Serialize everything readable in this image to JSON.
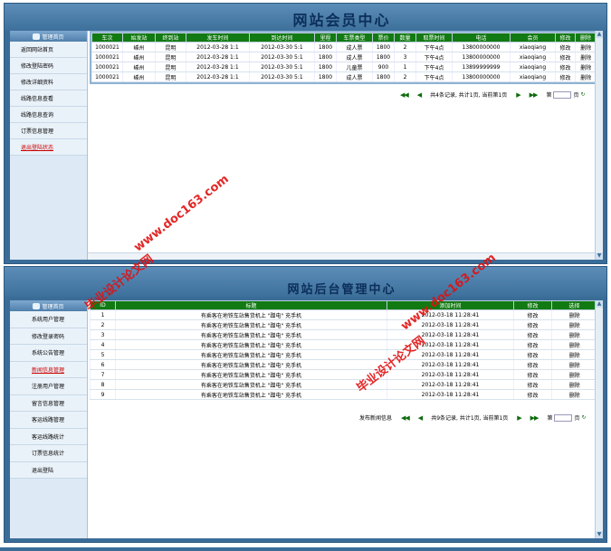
{
  "top": {
    "title": "网站会员中心",
    "sidebar": {
      "header": "管理首页",
      "items": [
        "返回网站首页",
        "修改登陆密码",
        "修改详细资料",
        "线路信息查看",
        "线路信息查询",
        "订票信息管理",
        "退出登陆状态"
      ]
    },
    "columns": [
      "车次",
      "始发站",
      "终到站",
      "发车时间",
      "到达时间",
      "里程",
      "车票类型",
      "票价",
      "数量",
      "取票时间",
      "电话",
      "会员",
      "修改",
      "删除"
    ],
    "rows": [
      [
        "1000021",
        "嵊州",
        "昆明",
        "2012-03-28 1:1",
        "2012-03-30 5:1",
        "1800",
        "成人票",
        "1800",
        "2",
        "下午4点",
        "13800000000",
        "xiaoqiang",
        "修改",
        "删除"
      ],
      [
        "1000021",
        "嵊州",
        "昆明",
        "2012-03-28 1:1",
        "2012-03-30 5:1",
        "1800",
        "成人票",
        "1800",
        "3",
        "下午4点",
        "13800000000",
        "xiaoqiang",
        "修改",
        "删除"
      ],
      [
        "1000021",
        "嵊州",
        "昆明",
        "2012-03-28 1:1",
        "2012-03-30 5:1",
        "1800",
        "儿童票",
        "900",
        "1",
        "下午4点",
        "13899999999",
        "xiaoqiang",
        "修改",
        "删除"
      ],
      [
        "1000021",
        "嵊州",
        "昆明",
        "2012-03-28 1:1",
        "2012-03-30 5:1",
        "1800",
        "成人票",
        "1800",
        "2",
        "下午4点",
        "13800000000",
        "xiaoqiang",
        "修改",
        "删除"
      ]
    ],
    "pager": {
      "first": "◀◀",
      "prev": "◀",
      "summary": "共4条记录, 共计1页, 当前第1页",
      "next": "▶",
      "last": "▶▶",
      "page_label": "第",
      "page_unit": "页"
    }
  },
  "bottom": {
    "title": "网站后台管理中心",
    "sidebar": {
      "header": "管理首页",
      "items": [
        "系统用户管理",
        "修改登录密码",
        "系统公告管理",
        "新闻信息管理",
        "注册用户管理",
        "留言信息管理",
        "客运线路管理",
        "客运线路统计",
        "订票信息统计",
        "退出登陆"
      ]
    },
    "columns": [
      "ID",
      "标题",
      "添加时间",
      "修改",
      "选择"
    ],
    "rows": [
      [
        "1",
        "有乘客在地铁车站售货机上 \"蹭电\" 充手机",
        "2012-03-18 11:28:41",
        "修改",
        "删除"
      ],
      [
        "2",
        "有乘客在地铁车站售货机上 \"蹭电\" 充手机",
        "2012-03-18 11:28:41",
        "修改",
        "删除"
      ],
      [
        "3",
        "有乘客在地铁车站售货机上 \"蹭电\" 充手机",
        "2012-03-18 11:28:41",
        "修改",
        "删除"
      ],
      [
        "4",
        "有乘客在地铁车站售货机上 \"蹭电\" 充手机",
        "2012-03-18 11:28:41",
        "修改",
        "删除"
      ],
      [
        "5",
        "有乘客在地铁车站售货机上 \"蹭电\" 充手机",
        "2012-03-18 11:28:41",
        "修改",
        "删除"
      ],
      [
        "6",
        "有乘客在地铁车站售货机上 \"蹭电\" 充手机",
        "2012-03-18 11:28:41",
        "修改",
        "删除"
      ],
      [
        "7",
        "有乘客在地铁车站售货机上 \"蹭电\" 充手机",
        "2012-03-18 11:28:41",
        "修改",
        "删除"
      ],
      [
        "8",
        "有乘客在地铁车站售货机上 \"蹭电\" 充手机",
        "2012-03-18 11:28:41",
        "修改",
        "删除"
      ],
      [
        "9",
        "有乘客在地铁车站售货机上 \"蹭电\" 充手机",
        "2012-03-18 11:28:41",
        "修改",
        "删除"
      ]
    ],
    "pager": {
      "publish": "发布新闻信息",
      "first": "◀◀",
      "prev": "◀",
      "summary": "共9条记录, 共计1页, 当前第1页",
      "next": "▶",
      "last": "▶▶",
      "page_label": "第",
      "page_unit": "页"
    }
  },
  "watermarks": [
    "www.doc163.com",
    "毕业设计论文网",
    "www.doc163.com",
    "毕业设计论文网"
  ]
}
